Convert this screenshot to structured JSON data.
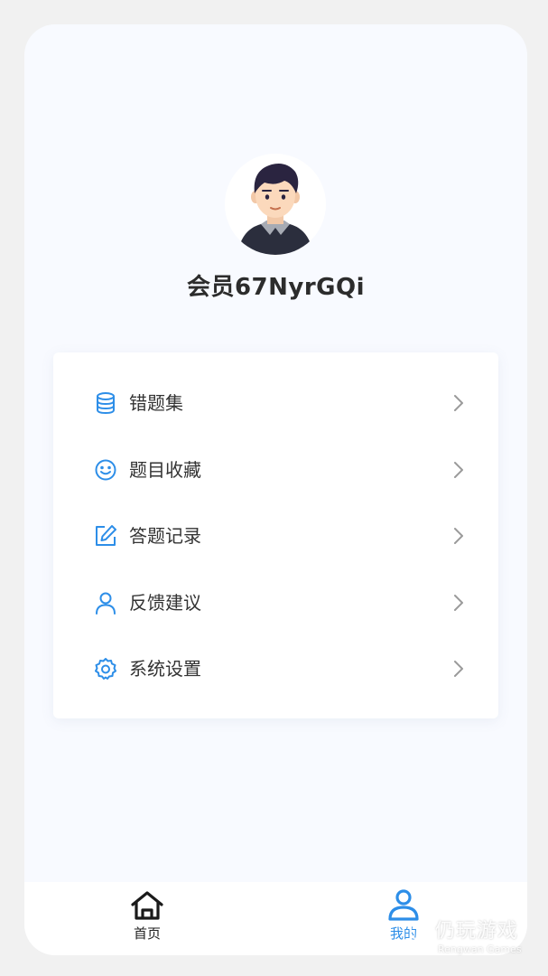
{
  "profile": {
    "username": "会员67NyrGQi",
    "avatar_icon": "boy-avatar-icon"
  },
  "menu": [
    {
      "label": "错题集",
      "icon": "database-icon"
    },
    {
      "label": "题目收藏",
      "icon": "smiley-icon"
    },
    {
      "label": "答题记录",
      "icon": "edit-icon"
    },
    {
      "label": "反馈建议",
      "icon": "user-icon"
    },
    {
      "label": "系统设置",
      "icon": "gear-icon"
    }
  ],
  "tabbar": {
    "home_label": "首页",
    "mine_label": "我的"
  },
  "watermark": {
    "title": "仍玩游戏",
    "subtitle": "Rengwan Games"
  },
  "colors": {
    "accent": "#2d8ee8",
    "text": "#333333",
    "background": "#f8faff"
  }
}
